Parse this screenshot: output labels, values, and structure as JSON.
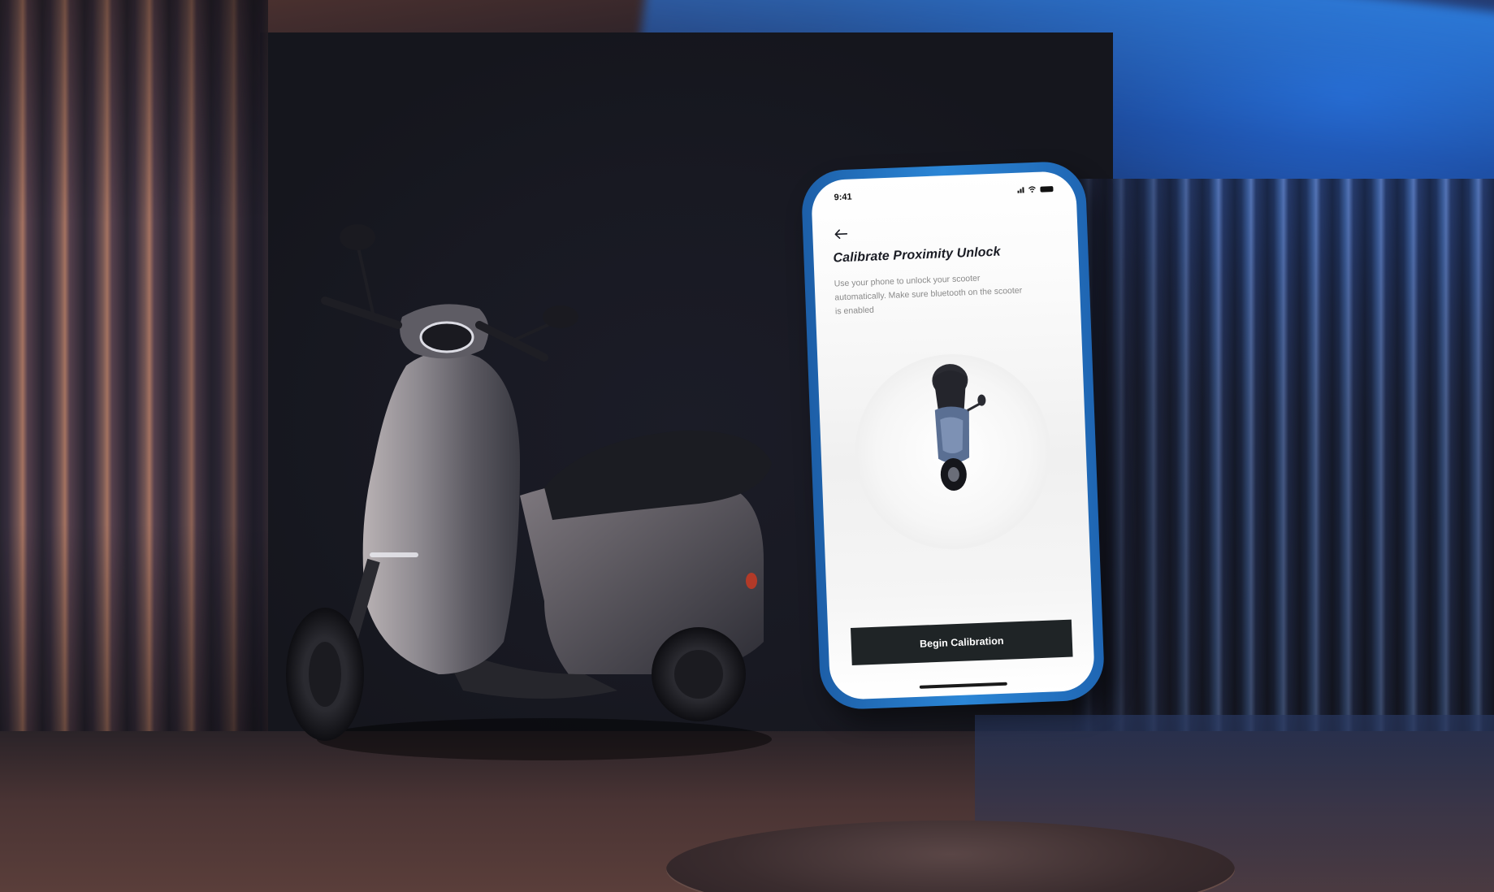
{
  "phone": {
    "status_time": "9:41",
    "screen_title": "Calibrate Proximity Unlock",
    "description": "Use your phone to unlock your scooter automatically. Make sure bluetooth on the scooter is enabled",
    "primary_button_label": "Begin Calibration",
    "icons": {
      "back": "arrow-left-icon",
      "signal": "cellular-signal-icon",
      "wifi": "wifi-icon",
      "battery": "battery-icon"
    }
  },
  "colors": {
    "phone_frame": "#2b86d6",
    "button_bg": "#1f2426",
    "button_text": "#ffffff",
    "title_text": "#1a1c24",
    "scooter_body": "#8d8b91",
    "scooter_seat": "#1b1c22",
    "mini_scooter": "#5a6f93"
  }
}
